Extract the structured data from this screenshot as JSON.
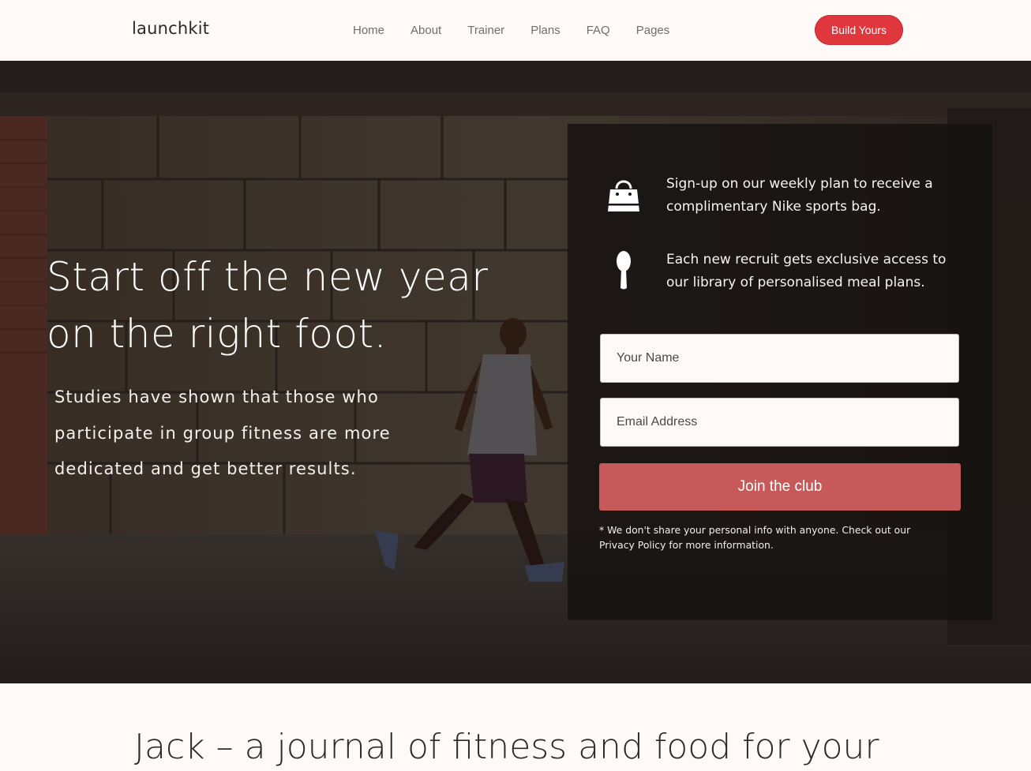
{
  "nav": {
    "logo": "launchkit",
    "links": [
      "Home",
      "About",
      "Trainer",
      "Plans",
      "FAQ",
      "Pages"
    ],
    "cta_label": "Build Yours"
  },
  "hero": {
    "headline": "Start off the new year on the right foot.",
    "subtext": "Studies have shown that those who participate in group fitness are more dedicated and get better results."
  },
  "panel": {
    "features": [
      {
        "icon": "shopping-bag-icon",
        "text": "Sign-up on our weekly plan to receive a complimentary Nike sports bag."
      },
      {
        "icon": "spoon-icon",
        "text": "Each new recruit gets exclusive access to our library of personalised meal plans."
      }
    ],
    "form": {
      "name_placeholder": "Your Name",
      "email_placeholder": "Email Address",
      "submit_label": "Join the club"
    },
    "disclaimer": "* We don't share your personal info with anyone. Check out our Privacy Policy for more information."
  },
  "below": {
    "heading_partial": "Jack – a journal of fitness and food for your"
  },
  "colors": {
    "accent": "#e0373f",
    "button": "#c65a5a",
    "background": "#fff9f8"
  }
}
